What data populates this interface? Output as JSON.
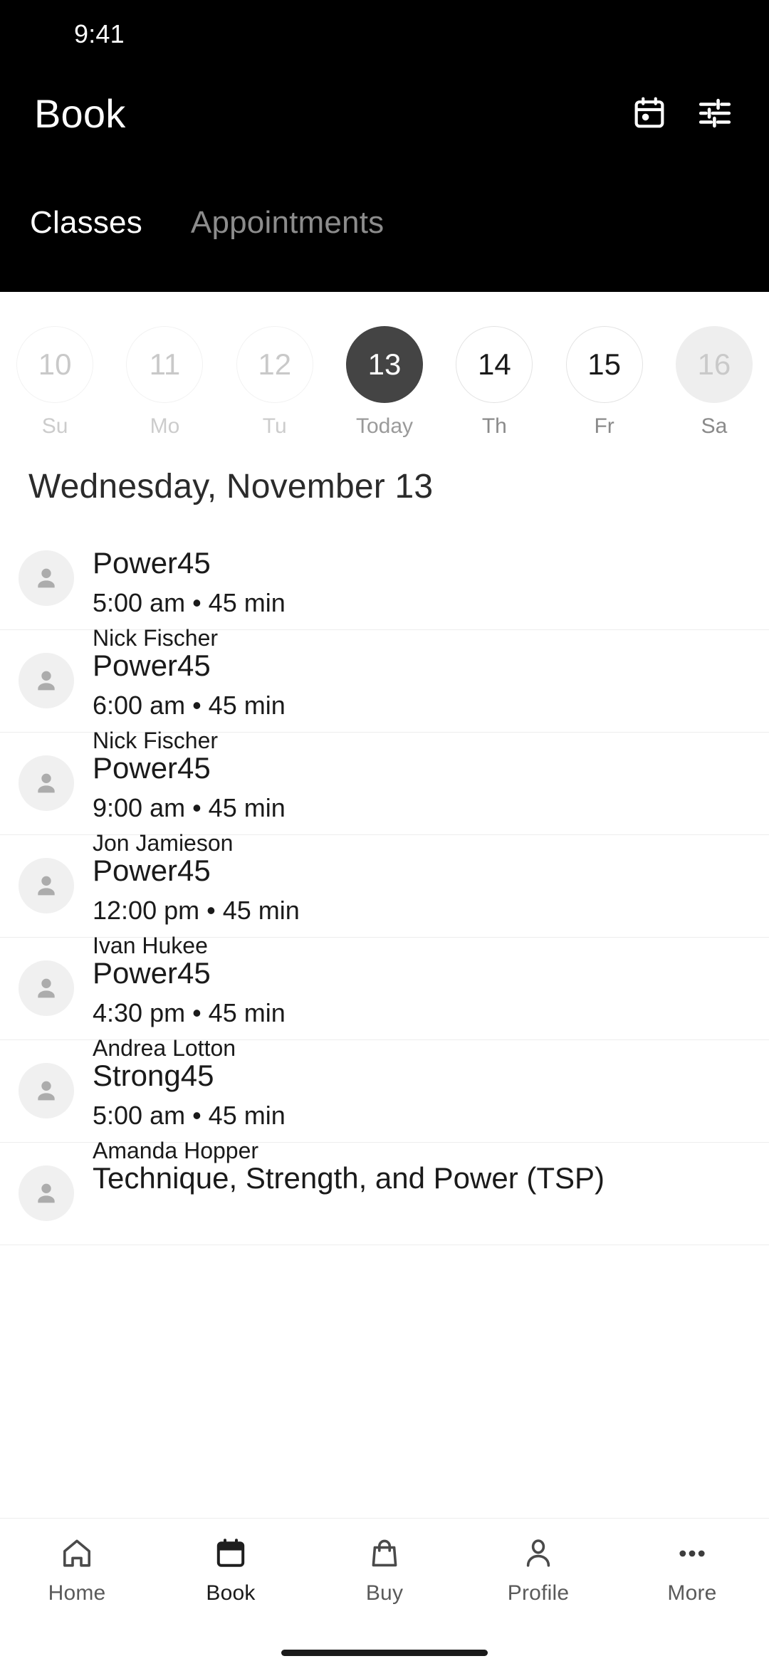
{
  "statusbar": {
    "time": "9:41"
  },
  "header": {
    "title": "Book",
    "actions": [
      {
        "name": "calendar-icon",
        "label": "Calendar"
      },
      {
        "name": "filter-icon",
        "label": "Filters"
      }
    ],
    "tabs": [
      {
        "label": "Classes",
        "active": true
      },
      {
        "label": "Appointments",
        "active": false
      }
    ]
  },
  "date_strip": [
    {
      "day": "10",
      "label": "Su",
      "state": "past"
    },
    {
      "day": "11",
      "label": "Mo",
      "state": "past"
    },
    {
      "day": "12",
      "label": "Tu",
      "state": "past"
    },
    {
      "day": "13",
      "label": "Today",
      "state": "selected"
    },
    {
      "day": "14",
      "label": "Th",
      "state": "available"
    },
    {
      "day": "15",
      "label": "Fr",
      "state": "available"
    },
    {
      "day": "16",
      "label": "Sa",
      "state": "muted"
    }
  ],
  "date_heading": "Wednesday, November 13",
  "classes": [
    {
      "name": "Power45",
      "meta": "5:00 am • 45 min",
      "instructor": "Nick Fischer"
    },
    {
      "name": "Power45",
      "meta": "6:00 am • 45 min",
      "instructor": "Nick Fischer"
    },
    {
      "name": "Power45",
      "meta": "9:00 am • 45 min",
      "instructor": "Jon Jamieson"
    },
    {
      "name": "Power45",
      "meta": "12:00 pm • 45 min",
      "instructor": "Ivan Hukee"
    },
    {
      "name": "Power45",
      "meta": "4:30 pm • 45 min",
      "instructor": "Andrea Lotton"
    },
    {
      "name": "Strong45",
      "meta": "5:00 am • 45 min",
      "instructor": "Amanda Hopper"
    },
    {
      "name": "Technique, Strength, and Power (TSP)",
      "meta": "",
      "instructor": ""
    }
  ],
  "bottom_nav": [
    {
      "label": "Home",
      "icon": "home-icon",
      "active": false
    },
    {
      "label": "Book",
      "icon": "calendar-icon",
      "active": true
    },
    {
      "label": "Buy",
      "icon": "shopping-bag-icon",
      "active": false
    },
    {
      "label": "Profile",
      "icon": "person-icon",
      "active": false
    },
    {
      "label": "More",
      "icon": "ellipsis-icon",
      "active": false
    }
  ],
  "colors": {
    "header_bg": "#000000",
    "selected_day": "#444444",
    "muted_day": "#eeeeee",
    "divider": "#ededed",
    "text_primary": "#1a1a1a",
    "text_muted": "#8a8a8a"
  }
}
